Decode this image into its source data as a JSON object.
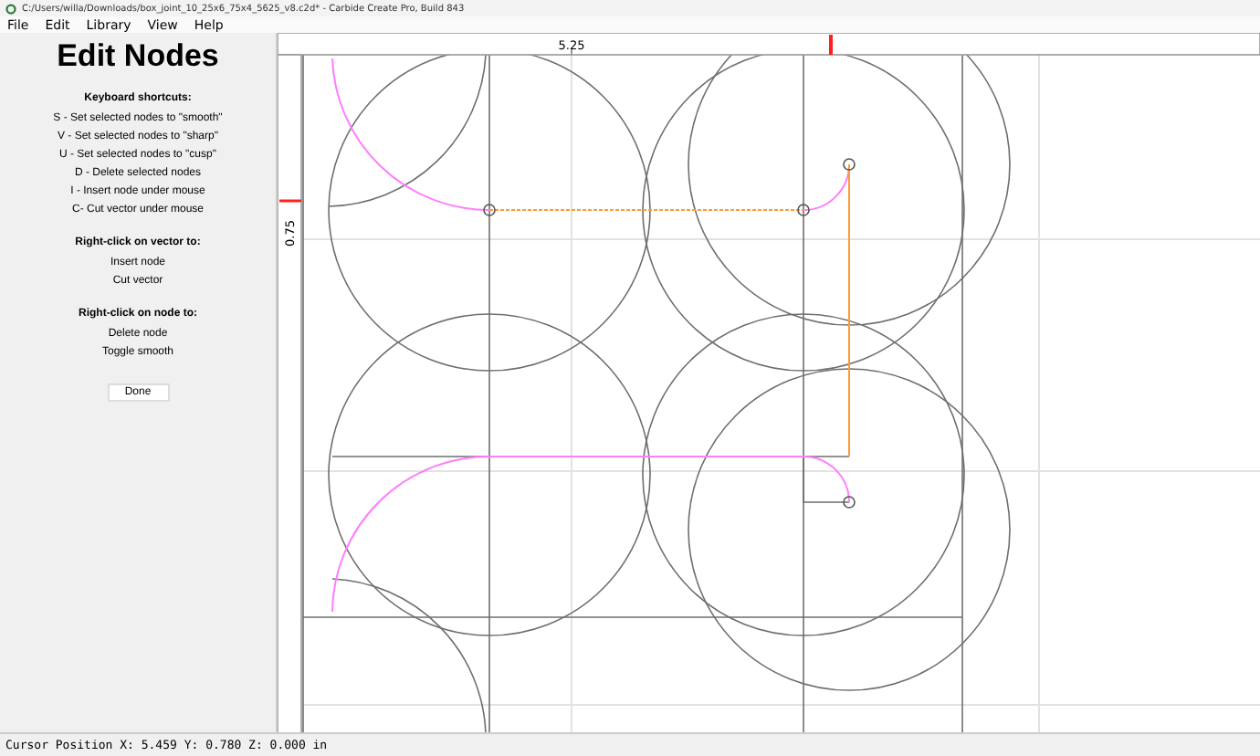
{
  "window": {
    "title": "C:/Users/willa/Downloads/box_joint_10_25x6_75x4_5625_v8.c2d* - Carbide Create Pro, Build 843"
  },
  "menu": [
    "File",
    "Edit",
    "Library",
    "View",
    "Help"
  ],
  "panel": {
    "title": "Edit Nodes",
    "sections": [
      {
        "heading": "Keyboard shortcuts:",
        "lines": [
          "S - Set selected nodes to \"smooth\"",
          "V - Set selected nodes to \"sharp\"",
          "U - Set selected nodes to \"cusp\"",
          "D - Delete selected nodes",
          "I - Insert node under mouse",
          "C- Cut vector under mouse"
        ]
      },
      {
        "heading": "Right-click on vector to:",
        "lines": [
          "Insert node",
          "Cut vector"
        ]
      },
      {
        "heading": "Right-click on node to:",
        "lines": [
          "Delete node",
          "Toggle smooth"
        ]
      }
    ],
    "button": "Done"
  },
  "rulers": {
    "top_label": "5.25",
    "left_label": "0.75"
  },
  "status_bar": "Cursor Position X: 5.459 Y: 0.780 Z: 0.000 in"
}
